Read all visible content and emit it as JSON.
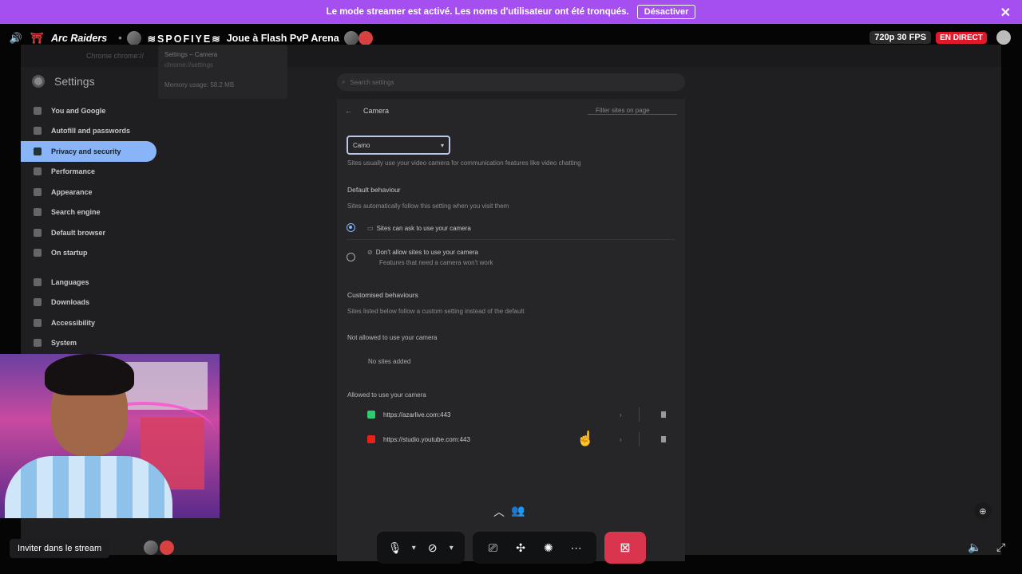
{
  "banner": {
    "message": "Le mode streamer est activé. Les noms d'utilisateur ont été tronqués.",
    "button": "Désactiver",
    "close": "✕"
  },
  "stream": {
    "game": "Arc Raiders",
    "game_icon": "⛩",
    "separator": "•",
    "streamer": "≋SPOFIYE≋",
    "activity": "Joue à Flash PvP Arena",
    "quality": "720p 30 FPS",
    "live": "EN DIRECT"
  },
  "chrome": {
    "tab_title": "Settings – Camera",
    "tab_url": "chrome://settings",
    "memory": "Memory usage: 58.2 MB",
    "address": "Chrome  chrome://",
    "settings_title": "Settings",
    "search_placeholder": "Search settings"
  },
  "nav": {
    "items": [
      {
        "label": "You and Google"
      },
      {
        "label": "Autofill and passwords"
      },
      {
        "label": "Privacy and security"
      },
      {
        "label": "Performance"
      },
      {
        "label": "Appearance"
      },
      {
        "label": "Search engine"
      },
      {
        "label": "Default browser"
      },
      {
        "label": "On startup"
      },
      {
        "label": "Languages"
      },
      {
        "label": "Downloads"
      },
      {
        "label": "Accessibility"
      },
      {
        "label": "System"
      }
    ]
  },
  "camera": {
    "title": "Camera",
    "filter": "Filter sites on page",
    "selected_device": "Camo",
    "desc": "Sites usually use your video camera for communication features like video chatting",
    "default_header": "Default behaviour",
    "default_desc": "Sites automatically follow this setting when you visit them",
    "option_allow": "Sites can ask to use your camera",
    "option_block": "Don't allow sites to use your camera",
    "option_block_sub": "Features that need a camera won't work",
    "custom_header": "Customised behaviours",
    "custom_desc": "Sites listed below follow a custom setting instead of the default",
    "not_allowed_header": "Not allowed to use your camera",
    "no_sites": "No sites added",
    "allowed_header": "Allowed to use your camera",
    "allowed_sites": [
      {
        "url": "https://azarlive.com:443",
        "color": "#2ecc71"
      },
      {
        "url": "https://studio.youtube.com:443",
        "color": "#e62117"
      }
    ]
  },
  "bottom": {
    "invite": "Inviter dans le stream"
  },
  "colors": {
    "banner": "#a64ff0",
    "live": "#e0192a",
    "end_call": "#d9354f",
    "active_nav": "#8ab4f8"
  }
}
